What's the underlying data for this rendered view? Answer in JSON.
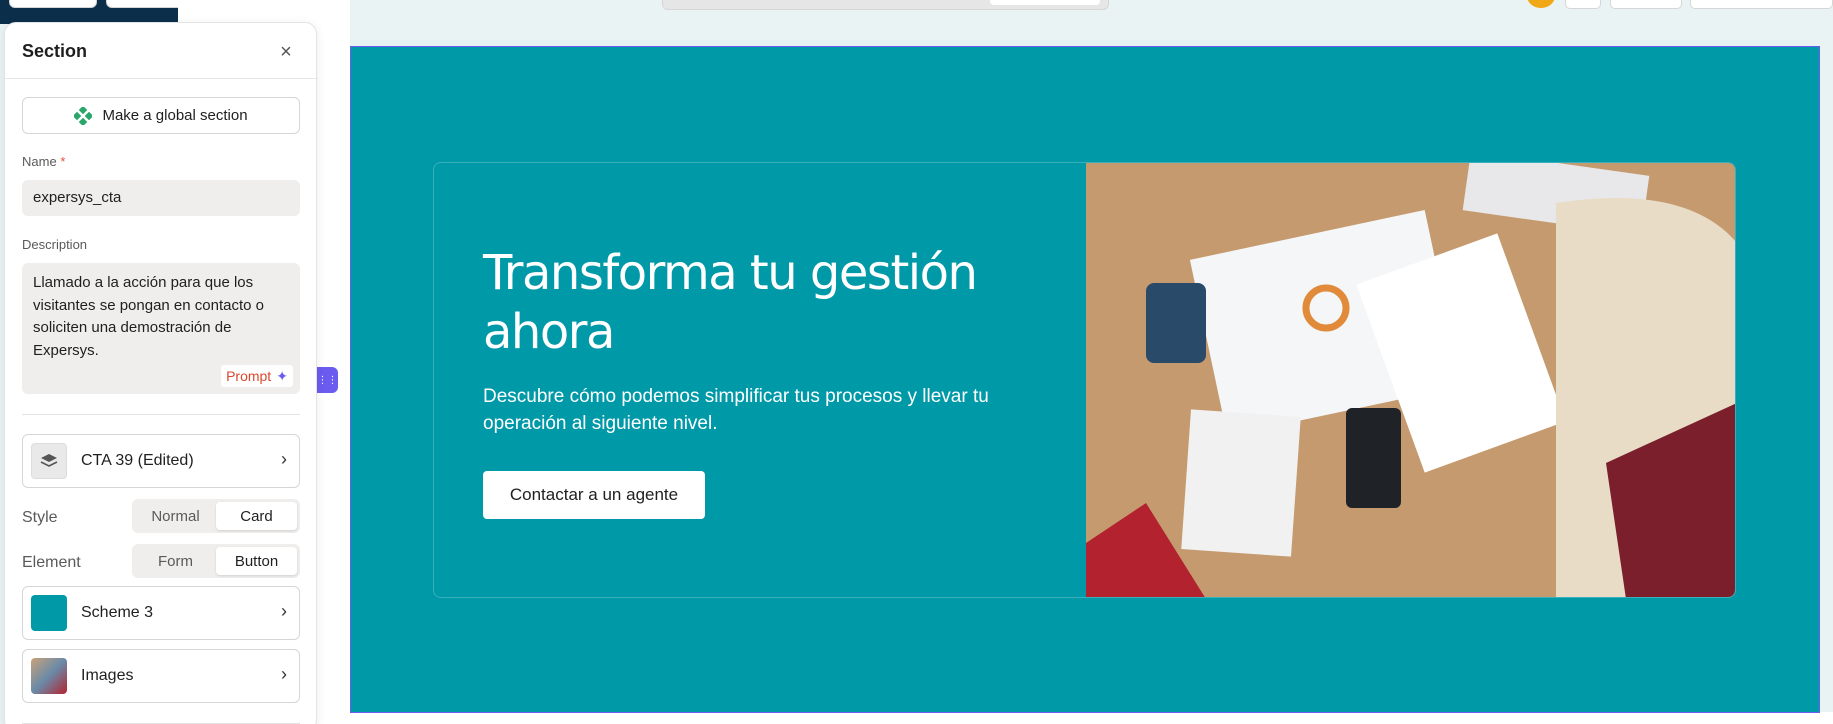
{
  "panel": {
    "title": "Section",
    "global_button_label": "Make a global section",
    "name_label": "Name",
    "name_required_mark": "*",
    "name_value": "expersys_cta",
    "description_label": "Description",
    "description_value": "Llamado a la acción para que los visitantes se pongan en contacto o soliciten una demostración de Expersys.",
    "prompt_label": "Prompt",
    "template_item": "CTA 39 (Edited)",
    "style": {
      "label": "Style",
      "options": [
        "Normal",
        "Card"
      ],
      "selected": "Card"
    },
    "element": {
      "label": "Element",
      "options": [
        "Form",
        "Button"
      ],
      "selected": "Button"
    },
    "scheme_item": "Scheme 3",
    "images_item": "Images"
  },
  "canvas": {
    "title": "Transforma tu gestión ahora",
    "description": "Descubre cómo podemos simplificar tus procesos y llevar tu operación al siguiente nivel.",
    "button_label": "Contactar a un agente"
  },
  "icons": {
    "global": "diamond-cluster-icon",
    "close": "close-icon",
    "layers": "layers-icon",
    "chevron": "chevron-right-icon",
    "drag": "grid-dots-icon",
    "spark": "sparkle-icon"
  },
  "colors": {
    "section_bg": "#0099a8",
    "accent": "#6b5cf0",
    "global_icon": "#2aa66a",
    "prompt_text": "#d9472f",
    "panel_bg": "#ffffff"
  }
}
